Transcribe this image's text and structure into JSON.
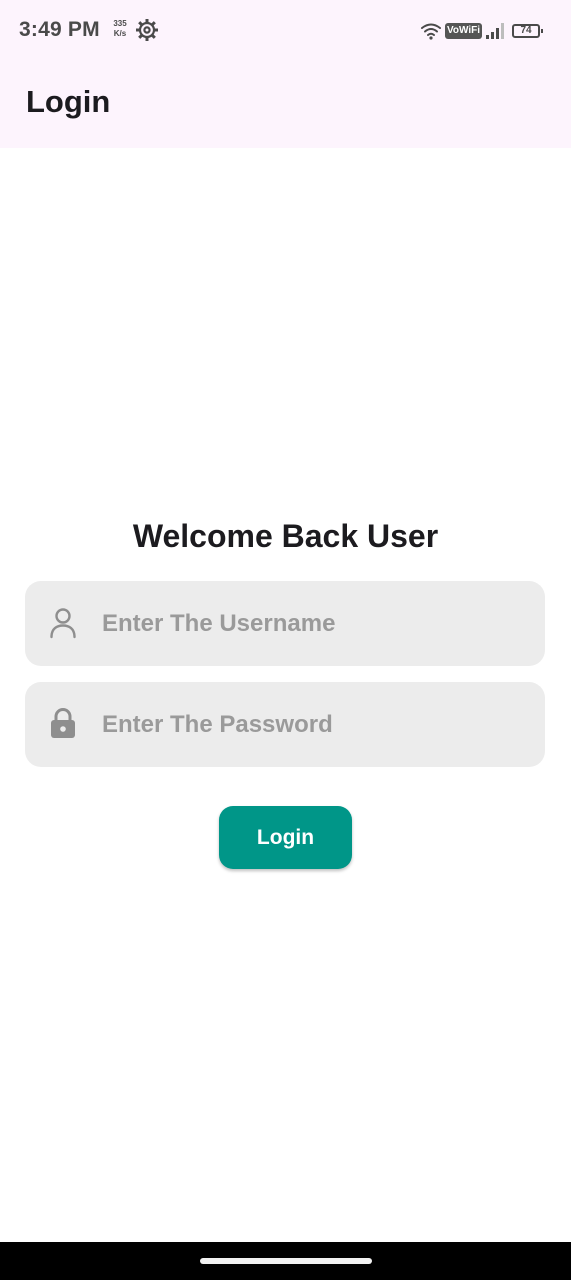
{
  "status_bar": {
    "time": "3:49 PM",
    "net_speed_value": "335",
    "net_speed_unit": "K/s",
    "vowifi_label": "VoWiFi",
    "battery_level": "74"
  },
  "app_bar": {
    "title": "Login"
  },
  "login_form": {
    "heading": "Welcome Back User",
    "username_placeholder": "Enter The Username",
    "password_placeholder": "Enter The Password",
    "login_button_label": "Login"
  },
  "icons": {
    "username_field": "person-icon",
    "password_field": "lock-icon",
    "status_settings": "gear-icon",
    "status_wifi": "wifi-icon",
    "status_signal": "signal-icon",
    "status_battery": "battery-icon"
  },
  "colors": {
    "app_bar_bg": "#fdf4fd",
    "field_bg": "#ececec",
    "button_bg": "#009688",
    "placeholder_text": "#9a9a9a",
    "icon_gray": "#8e8e8e"
  }
}
